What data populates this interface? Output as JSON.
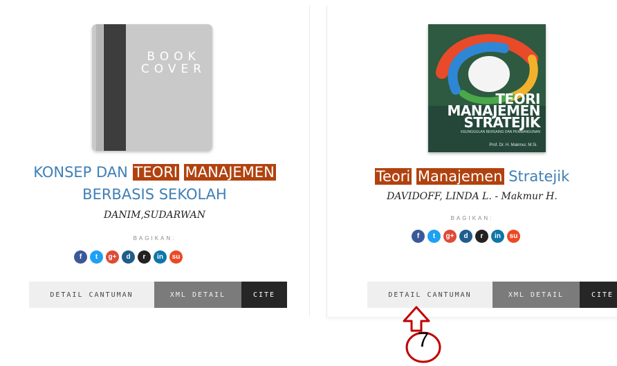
{
  "share_label": "BAGIKAN:",
  "buttons": {
    "detail": "DETAIL CANTUMAN",
    "xml": "XML DETAIL",
    "cite": "CITE"
  },
  "social_icons": [
    {
      "name": "facebook-icon",
      "glyph": "f",
      "color": "#3b5998"
    },
    {
      "name": "twitter-icon",
      "glyph": "t",
      "color": "#1da1f2"
    },
    {
      "name": "google-plus-icon",
      "glyph": "g+",
      "color": "#dd4b39"
    },
    {
      "name": "digg-icon",
      "glyph": "d",
      "color": "#1f5d8c"
    },
    {
      "name": "reddit-icon",
      "glyph": "r",
      "color": "#222222"
    },
    {
      "name": "linkedin-icon",
      "glyph": "in",
      "color": "#0e76a8"
    },
    {
      "name": "stumbleupon-icon",
      "glyph": "su",
      "color": "#eb4924"
    }
  ],
  "books": [
    {
      "title_parts": [
        {
          "text": "KONSEP DAN ",
          "highlight": false
        },
        {
          "text": "TEORI",
          "highlight": true
        },
        {
          "text": " ",
          "highlight": false
        },
        {
          "text": "MANAJEMEN",
          "highlight": true
        }
      ],
      "title_line2": "BERBASIS SEKOLAH",
      "author": "DANIM,SUDARWAN",
      "cover": {
        "type": "generic",
        "text": "BOOK COVER"
      }
    },
    {
      "title_parts": [
        {
          "text": "Teori",
          "highlight": true
        },
        {
          "text": " ",
          "highlight": false
        },
        {
          "text": "Manajemen",
          "highlight": true
        },
        {
          "text": " Stratejik",
          "highlight": false
        }
      ],
      "author": "DAVIDOFF, LINDA L. - Makmur H.",
      "cover": {
        "type": "image",
        "title": "TEORI MANAJEMEN STRATEJIK",
        "subtitle": "KEUNGGULAN BERSAING DAN PEMBANGUNAN",
        "author": "Prof. Dr. H. Makmur, M.Si."
      }
    }
  ],
  "annotation": {
    "number": "7",
    "color": "#c00000"
  }
}
